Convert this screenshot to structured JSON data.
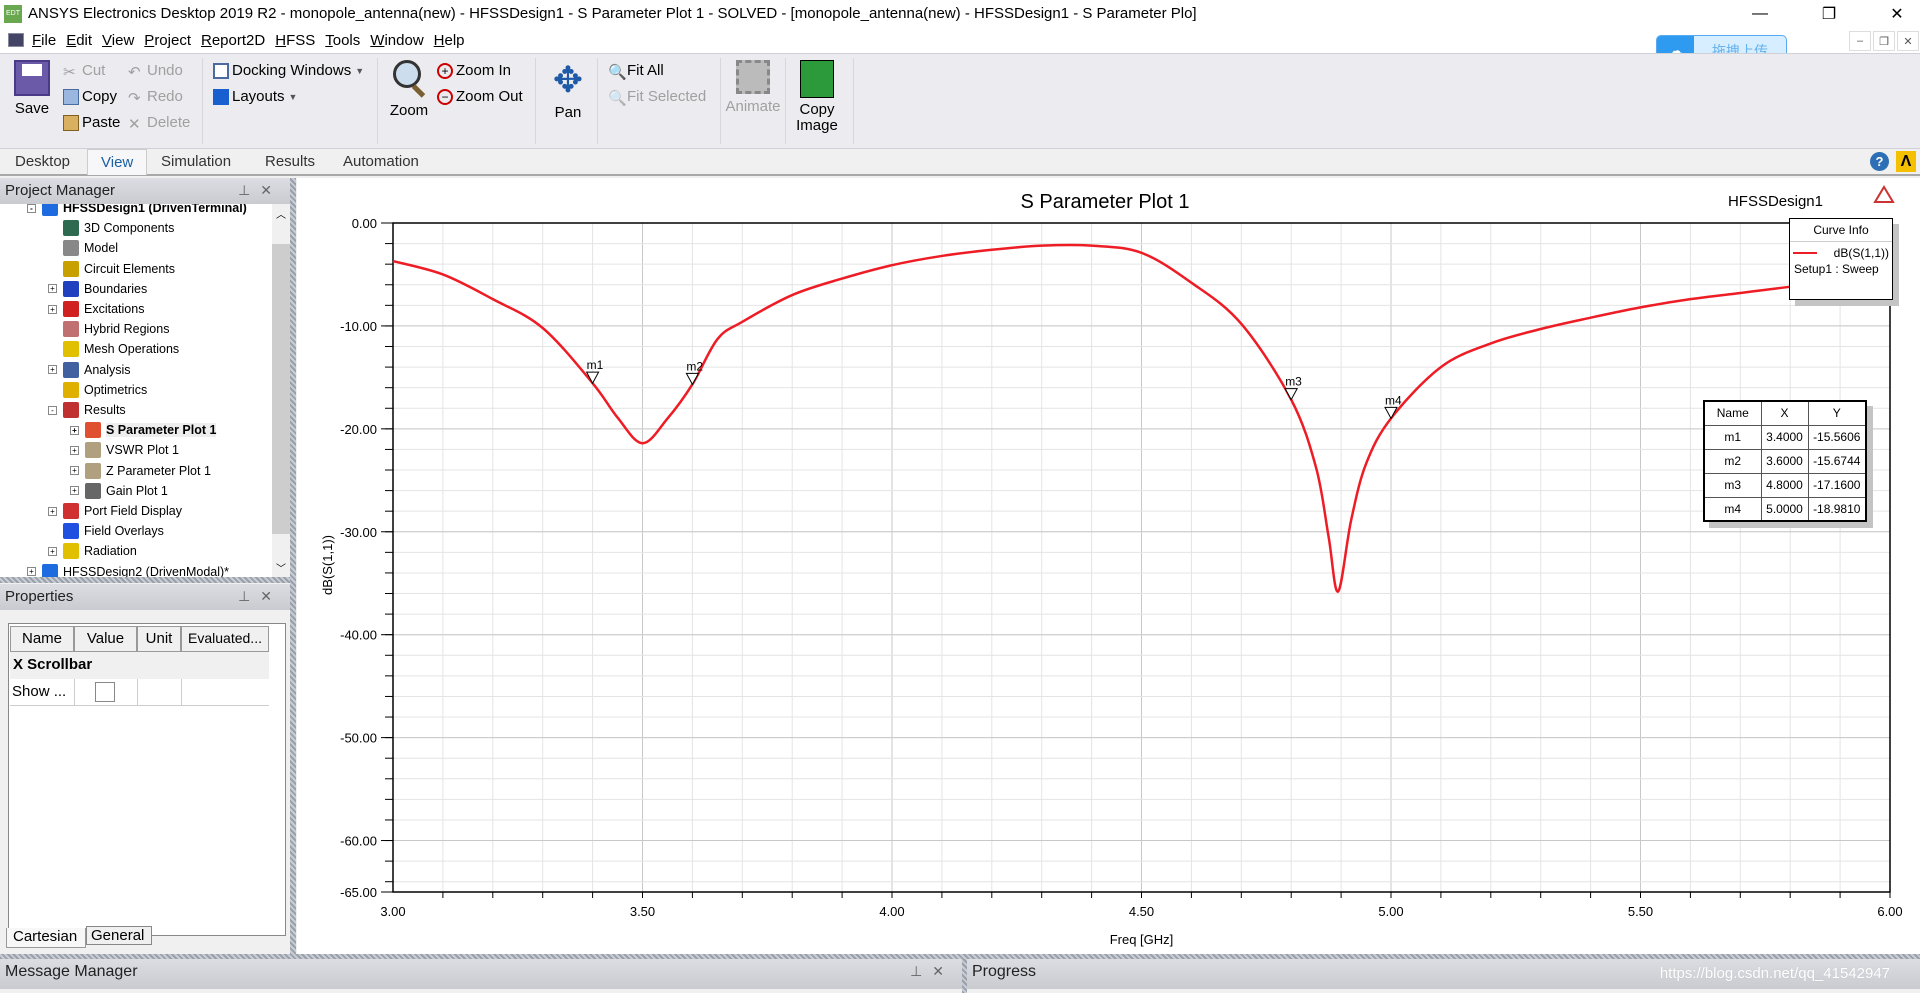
{
  "window": {
    "title": "ANSYS Electronics Desktop 2019 R2 - monopole_antenna(new) - HFSSDesign1 - S Parameter Plot 1 - SOLVED - [monopole_antenna(new) - HFSSDesign1 - S Parameter Plo]",
    "logo": "EDT"
  },
  "menu": [
    "File",
    "Edit",
    "View",
    "Project",
    "Report2D",
    "HFSS",
    "Tools",
    "Window",
    "Help"
  ],
  "upload": {
    "label": "拖拽上传"
  },
  "ribbon": {
    "save": "Save",
    "cut": "Cut",
    "copy": "Copy",
    "paste": "Paste",
    "undo": "Undo",
    "redo": "Redo",
    "delete": "Delete",
    "docking": "Docking Windows",
    "layouts": "Layouts",
    "zoom": "Zoom",
    "zoom_in": "Zoom In",
    "zoom_out": "Zoom Out",
    "pan": "Pan",
    "fit_all": "Fit All",
    "fit_selected": "Fit Selected",
    "animate": "Animate",
    "copy_image_1": "Copy",
    "copy_image_2": "Image"
  },
  "tabs": [
    {
      "label": "Desktop"
    },
    {
      "label": "View",
      "active": true
    },
    {
      "label": "Simulation"
    },
    {
      "label": "Results"
    },
    {
      "label": "Automation"
    }
  ],
  "project_manager": {
    "title": "Project Manager",
    "items": [
      {
        "label": "HFSSDesign1 (DrivenTerminal)",
        "bold": true,
        "exp": "-",
        "color": "#1e6be0"
      },
      {
        "label": "3D Components",
        "color": "#2d6a4f"
      },
      {
        "label": "Model",
        "color": "#888"
      },
      {
        "label": "Circuit Elements",
        "color": "#c8a000"
      },
      {
        "label": "Boundaries",
        "exp": "+",
        "color": "#2040c0"
      },
      {
        "label": "Excitations",
        "exp": "+",
        "color": "#d02020"
      },
      {
        "label": "Hybrid Regions",
        "color": "#c07070"
      },
      {
        "label": "Mesh Operations",
        "color": "#e0c000"
      },
      {
        "label": "Analysis",
        "exp": "+",
        "color": "#4060a0"
      },
      {
        "label": "Optimetrics",
        "color": "#e0b000"
      },
      {
        "label": "Results",
        "exp": "-",
        "color": "#c03030"
      },
      {
        "label": "S Parameter Plot 1",
        "bold": true,
        "exp": "+",
        "lvl": 2,
        "color": "#e05030"
      },
      {
        "label": "VSWR Plot 1",
        "exp": "+",
        "lvl": 2,
        "color": "#b0a080"
      },
      {
        "label": "Z Parameter Plot 1",
        "exp": "+",
        "lvl": 2,
        "color": "#b0a080"
      },
      {
        "label": "Gain Plot 1",
        "exp": "+",
        "lvl": 2,
        "color": "#666"
      },
      {
        "label": "Port Field Display",
        "exp": "+",
        "color": "#d03030"
      },
      {
        "label": "Field Overlays",
        "color": "#2050e0"
      },
      {
        "label": "Radiation",
        "exp": "+",
        "color": "#e0c000"
      },
      {
        "label": "HFSSDesign2 (DrivenModal)*",
        "exp": "+",
        "lvl": 0,
        "color": "#1e6be0"
      }
    ]
  },
  "properties": {
    "title": "Properties",
    "headers": [
      "Name",
      "Value",
      "Unit",
      "Evaluated..."
    ],
    "group": "X Scrollbar",
    "row": {
      "name": "Show ...",
      "checked": false
    },
    "tabs": [
      "Cartesian",
      "General"
    ]
  },
  "bottom": {
    "message_manager": "Message Manager",
    "progress": "Progress",
    "watermark": "https://blog.csdn.net/qq_41542947"
  },
  "chart_data": {
    "type": "line",
    "title": "S Parameter Plot 1",
    "design_label": "HFSSDesign1",
    "xlabel": "Freq [GHz]",
    "ylabel": "dB(S(1,1))",
    "xlim": [
      3.0,
      6.0
    ],
    "ylim": [
      -65,
      0
    ],
    "xticks": [
      "3.00",
      "3.50",
      "4.00",
      "4.50",
      "5.00",
      "5.50",
      "6.00"
    ],
    "yticks": [
      "0.00",
      "-10.00",
      "-20.00",
      "-30.00",
      "-40.00",
      "-50.00",
      "-60.00",
      "-65.00"
    ],
    "grid": true,
    "legend": {
      "title": "Curve Info",
      "entry": "dB(S(1,1))",
      "sub": "Setup1 : Sweep",
      "placement": "top-right"
    },
    "series": [
      {
        "name": "dB(S(1,1))",
        "color": "#ee1c25",
        "x": [
          3.0,
          3.1,
          3.2,
          3.3,
          3.4,
          3.45,
          3.5,
          3.55,
          3.6,
          3.65,
          3.7,
          3.8,
          3.9,
          4.0,
          4.1,
          4.2,
          4.3,
          4.4,
          4.5,
          4.6,
          4.7,
          4.8,
          4.85,
          4.875,
          4.894,
          4.92,
          4.95,
          5.0,
          5.1,
          5.2,
          5.3,
          5.4,
          5.5,
          5.6,
          5.7,
          5.8,
          5.9,
          6.0
        ],
        "y": [
          -3.7,
          -5.0,
          -7.4,
          -10.2,
          -15.56,
          -18.9,
          -21.4,
          -19.0,
          -15.67,
          -11.3,
          -9.6,
          -7.0,
          -5.4,
          -4.1,
          -3.2,
          -2.6,
          -2.2,
          -2.2,
          -2.9,
          -5.8,
          -9.8,
          -17.16,
          -23.8,
          -30.5,
          -35.8,
          -28.9,
          -23.4,
          -18.98,
          -14.0,
          -11.7,
          -10.3,
          -9.2,
          -8.2,
          -7.4,
          -6.8,
          -6.2,
          -5.7,
          -5.3
        ]
      }
    ],
    "markers": [
      {
        "name": "m1",
        "x": "3.4000",
        "y": "-15.5606"
      },
      {
        "name": "m2",
        "x": "3.6000",
        "y": "-15.6744"
      },
      {
        "name": "m3",
        "x": "4.8000",
        "y": "-17.1600"
      },
      {
        "name": "m4",
        "x": "5.0000",
        "y": "-18.9810"
      }
    ],
    "marker_table_headers": [
      "Name",
      "X",
      "Y"
    ]
  }
}
